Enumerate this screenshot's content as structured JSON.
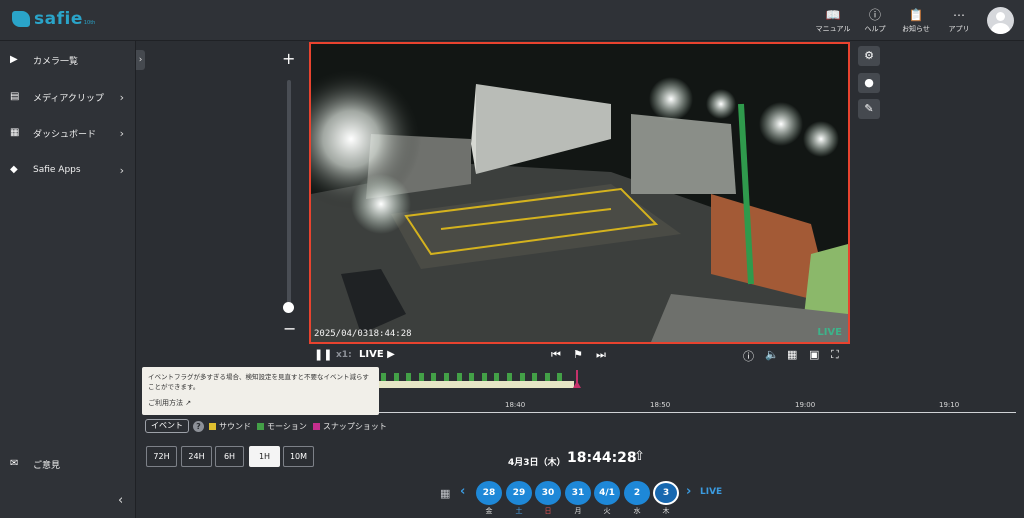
{
  "app": {
    "logo_text": "safie",
    "logo_sup": "10th"
  },
  "topbar": {
    "manual": "マニュアル",
    "help": "ヘルプ",
    "notice": "お知らせ",
    "apps": "アプリ"
  },
  "sidebar": {
    "items": [
      {
        "label": "カメラ一覧",
        "icon": "camera-icon"
      },
      {
        "label": "メディアクリップ",
        "icon": "clip-icon"
      },
      {
        "label": "ダッシュボード",
        "icon": "dashboard-icon"
      },
      {
        "label": "Safie Apps",
        "icon": "apps-leaf-icon"
      }
    ],
    "feedback": "ご意見"
  },
  "video": {
    "timestamp": "2025/04/0318:44:28",
    "live_badge": "LIVE"
  },
  "player": {
    "speed": "x1:",
    "live": "LIVE"
  },
  "timeline": {
    "labels": [
      "18:40",
      "18:50",
      "19:00",
      "19:10"
    ]
  },
  "tooltip": {
    "text": "イベントフラグが多すぎる場合、検知設定を見直すと不要なイベント減らすことができます。",
    "link": "ご利用方法"
  },
  "legend": {
    "event_button": "イベント",
    "sound": "サウンド",
    "motion": "モーション",
    "snapshot": "スナップショット",
    "colors": {
      "sound": "#e0c030",
      "motion": "#43a047",
      "snapshot": "#c62f8e"
    }
  },
  "ranges": [
    {
      "label": "72H",
      "active": false
    },
    {
      "label": "24H",
      "active": false
    },
    {
      "label": "6H",
      "active": false
    },
    {
      "label": "1H",
      "active": true
    },
    {
      "label": "10M",
      "active": false
    }
  ],
  "datetime": {
    "date": "4月3日（木）",
    "time": "18:44:28"
  },
  "days": [
    {
      "num": "28",
      "dow": "金"
    },
    {
      "num": "29",
      "dow": "土"
    },
    {
      "num": "30",
      "dow": "日"
    },
    {
      "num": "31",
      "dow": "月"
    },
    {
      "num": "4/1",
      "dow": "火"
    },
    {
      "num": "2",
      "dow": "水"
    },
    {
      "num": "3",
      "dow": "木"
    }
  ],
  "live_link": "LIVE"
}
